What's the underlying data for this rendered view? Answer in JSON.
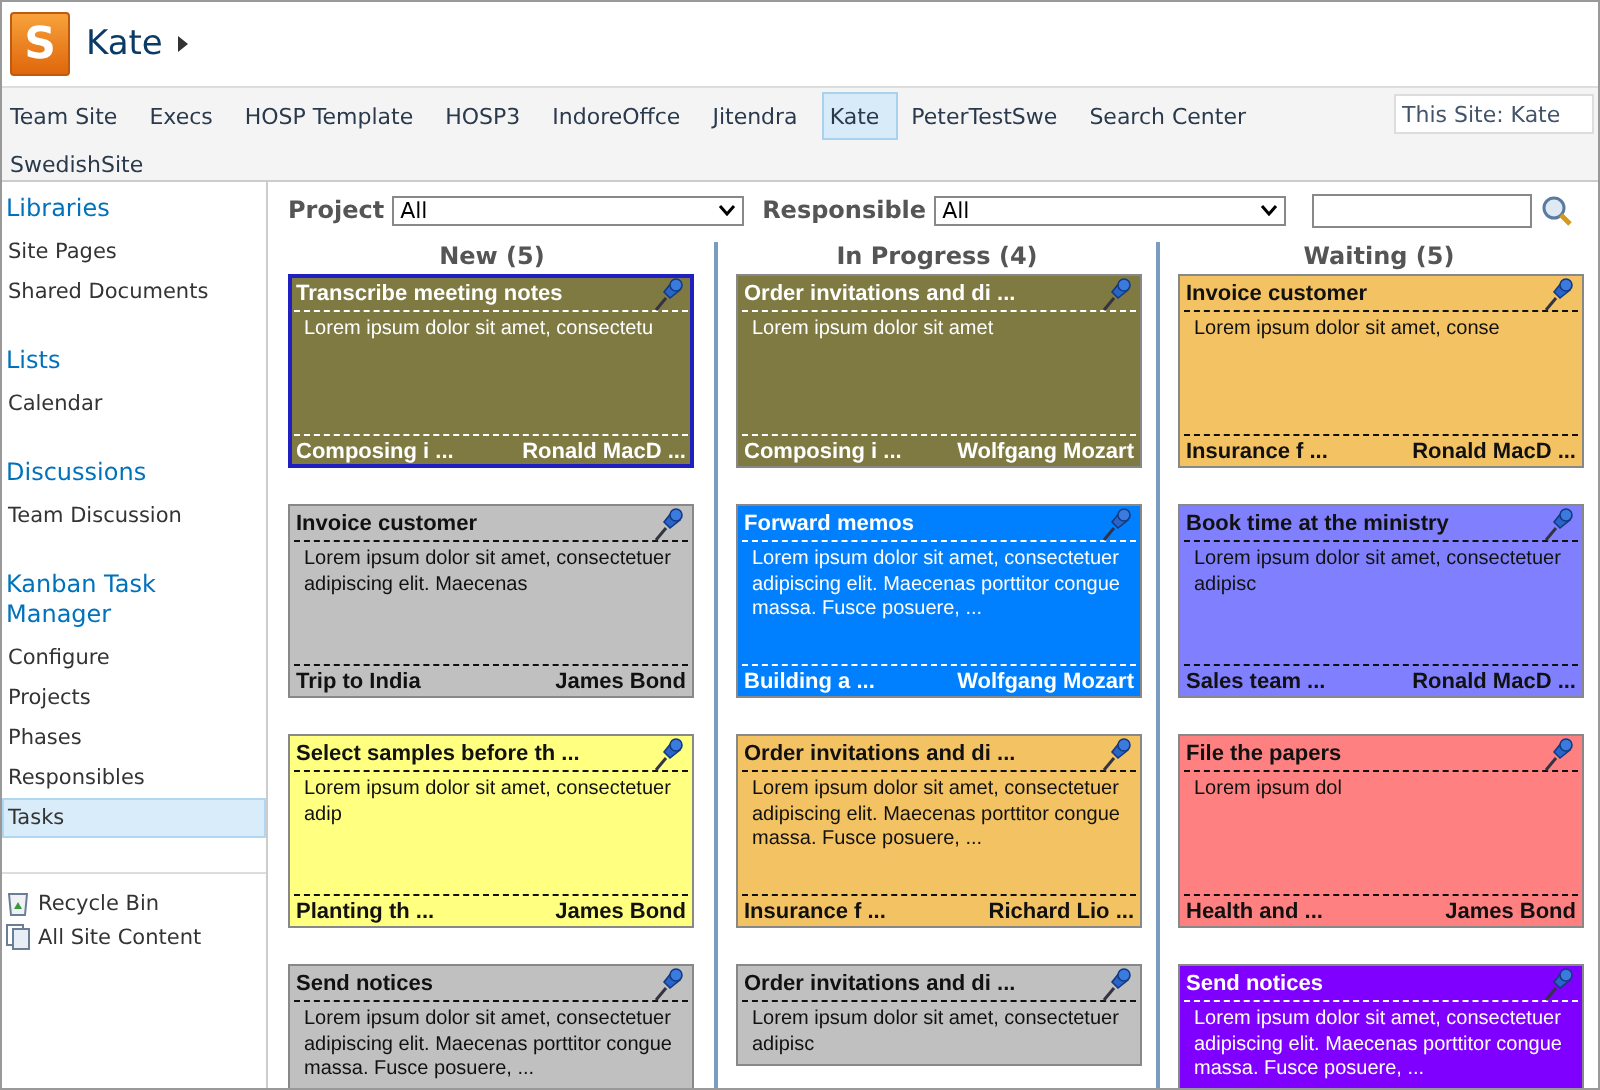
{
  "header": {
    "logo_text": "S",
    "title": "Kate"
  },
  "top_nav": {
    "items": [
      {
        "label": "Team Site",
        "selected": false
      },
      {
        "label": "Execs",
        "selected": false
      },
      {
        "label": "HOSP Template",
        "selected": false
      },
      {
        "label": "HOSP3",
        "selected": false
      },
      {
        "label": "IndoreOffce",
        "selected": false
      },
      {
        "label": "Jitendra",
        "selected": false
      },
      {
        "label": "Kate",
        "selected": true
      },
      {
        "label": "PeterTestSwe",
        "selected": false
      },
      {
        "label": "Search Center",
        "selected": false
      },
      {
        "label": "SwedishSite",
        "selected": false
      }
    ],
    "search": {
      "placeholder": "This Site: Kate"
    }
  },
  "sidebar": {
    "sections": [
      {
        "heading": "Libraries",
        "items": [
          {
            "label": "Site Pages",
            "selected": false
          },
          {
            "label": "Shared Documents",
            "selected": false
          }
        ]
      },
      {
        "heading": "Lists",
        "items": [
          {
            "label": "Calendar",
            "selected": false
          }
        ]
      },
      {
        "heading": "Discussions",
        "items": [
          {
            "label": "Team Discussion",
            "selected": false
          }
        ]
      },
      {
        "heading": "Kanban Task Manager",
        "items": [
          {
            "label": "Configure",
            "selected": false
          },
          {
            "label": "Projects",
            "selected": false
          },
          {
            "label": "Phases",
            "selected": false
          },
          {
            "label": "Responsibles",
            "selected": false
          },
          {
            "label": "Tasks",
            "selected": true
          }
        ]
      }
    ],
    "footer_links": [
      {
        "label": "Recycle Bin",
        "kind": "recycle"
      },
      {
        "label": "All Site Content",
        "kind": "content"
      }
    ]
  },
  "filters": {
    "project": {
      "label": "Project",
      "value": "All"
    },
    "responsible": {
      "label": "Responsible",
      "value": "All"
    }
  },
  "board": {
    "columns": [
      {
        "title": "New (5)",
        "cards": [
          {
            "title": "Transcribe meeting notes",
            "body": "Lorem ipsum dolor sit amet, consectetu",
            "footer_left": "Composing i ...",
            "footer_right": "Ronald MacD ...",
            "color": "#7f7a42",
            "selected": true
          },
          {
            "title": "Invoice customer",
            "body": "Lorem ipsum dolor sit amet, consectetuer adipiscing elit. Maecenas",
            "footer_left": "Trip to India",
            "footer_right": "James Bond",
            "color": "#c0c0c0",
            "selected": false
          },
          {
            "title": "Select samples before th ...",
            "body": "Lorem ipsum dolor sit amet, consectetuer adip",
            "footer_left": "Planting th ...",
            "footer_right": "James Bond",
            "color": "#ffff80",
            "selected": false
          },
          {
            "title": "Send notices",
            "body": "Lorem ipsum dolor sit amet, consectetuer adipiscing elit. Maecenas porttitor congue massa. Fusce posuere, ...",
            "color": "#c0c0c0",
            "selected": false
          }
        ]
      },
      {
        "title": "In Progress (4)",
        "cards": [
          {
            "title": "Order invitations and di ...",
            "body": "Lorem ipsum dolor sit amet",
            "footer_left": "Composing i ...",
            "footer_right": "Wolfgang Mozart",
            "color": "#7f7a42",
            "selected": false
          },
          {
            "title": "Forward memos",
            "body": "Lorem ipsum dolor sit amet, consectetuer adipiscing elit. Maecenas porttitor congue massa. Fusce posuere, ...",
            "footer_left": "Building a ...",
            "footer_right": "Wolfgang Mozart",
            "color": "#0080ff",
            "selected": false
          },
          {
            "title": "Order invitations and di ...",
            "body": "Lorem ipsum dolor sit amet, consectetuer adipiscing elit. Maecenas porttitor congue massa. Fusce posuere, ...",
            "footer_left": "Insurance f ...",
            "footer_right": "Richard Lio ...",
            "color": "#f3c262",
            "selected": false
          },
          {
            "title": "Order invitations and di ...",
            "body": "Lorem ipsum dolor sit amet, consectetuer adipisc",
            "color": "#c0c0c0",
            "selected": false
          }
        ]
      },
      {
        "title": "Waiting (5)",
        "cards": [
          {
            "title": "Invoice customer",
            "body": "Lorem ipsum dolor sit amet, conse",
            "footer_left": "Insurance f ...",
            "footer_right": "Ronald MacD ...",
            "color": "#f3c262",
            "selected": false
          },
          {
            "title": "Book time at the ministry",
            "body": "Lorem ipsum dolor sit amet, consectetuer adipisc",
            "footer_left": "Sales team ...",
            "footer_right": "Ronald MacD ...",
            "color": "#8080ff",
            "selected": false
          },
          {
            "title": "File the papers",
            "body": "Lorem ipsum dol",
            "footer_left": "Health and ...",
            "footer_right": "James Bond",
            "color": "#ff8080",
            "selected": false
          },
          {
            "title": "Send notices",
            "body": "Lorem ipsum dolor sit amet, consectetuer adipiscing elit. Maecenas porttitor congue massa. Fusce posuere, ...",
            "color": "#8000ff",
            "selected": false
          }
        ]
      }
    ]
  }
}
